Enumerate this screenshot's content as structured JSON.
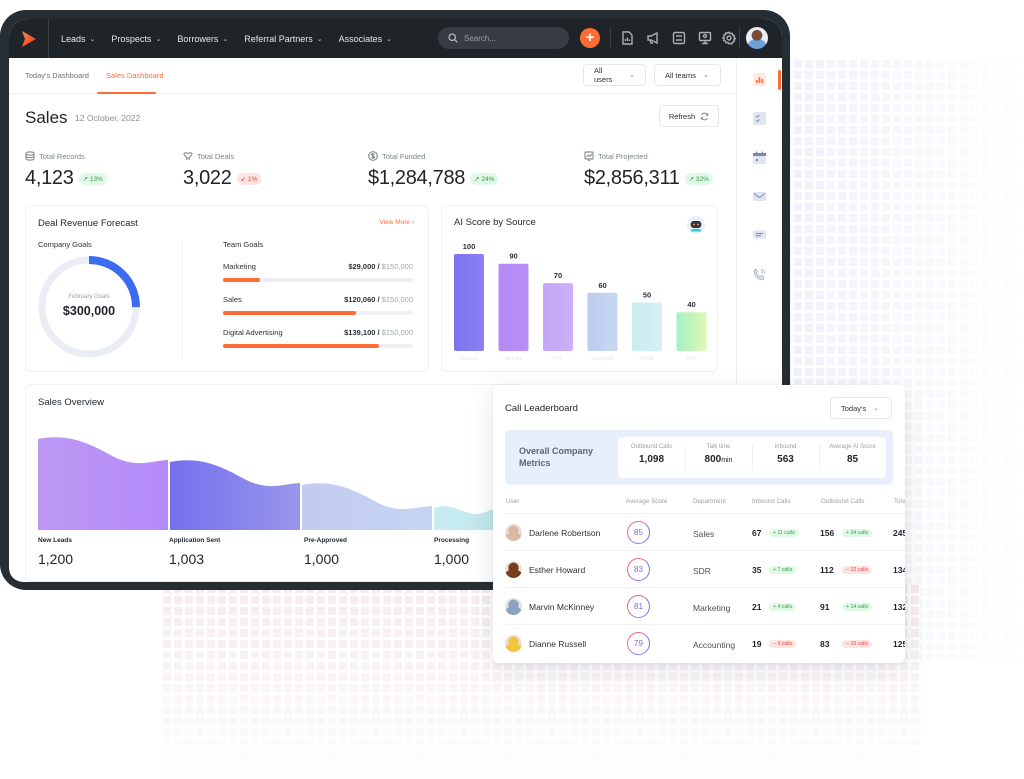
{
  "app": {
    "nav": [
      {
        "label": "Leads"
      },
      {
        "label": "Prospects"
      },
      {
        "label": "Borrowers"
      },
      {
        "label": "Referral Partners"
      },
      {
        "label": "Associates"
      }
    ],
    "search_placeholder": "Search...",
    "action_icons": [
      "report-icon",
      "megaphone-icon",
      "checklist-icon",
      "presentation-icon",
      "gear-icon"
    ],
    "accent": "#ff6b35"
  },
  "tabs": [
    {
      "label": "Today's Dashboard",
      "active": false
    },
    {
      "label": "Sales Dashboard",
      "active": true
    }
  ],
  "filters": {
    "users": "All users",
    "teams": "All teams"
  },
  "rail": [
    "bar-chart-icon",
    "checklist-icon",
    "calendar-icon",
    "mail-icon",
    "chat-icon",
    "phone-icon"
  ],
  "header": {
    "title": "Sales",
    "date": "12 October, 2022",
    "refresh_label": "Refresh"
  },
  "stats": [
    {
      "label": "Total Records",
      "value": "4,123",
      "change": "13%",
      "direction": "up"
    },
    {
      "label": "Total Deals",
      "value": "3,022",
      "change": "1%",
      "direction": "down"
    },
    {
      "label": "Total Funded",
      "value": "$1,284,788",
      "change": "24%",
      "direction": "up"
    },
    {
      "label": "Total Projected",
      "value": "$2,856,311",
      "change": "32%",
      "direction": "up"
    }
  ],
  "forecast": {
    "title": "Deal Revenue Forecast",
    "view_more": "View More",
    "company_goals_label": "Company Goals",
    "donut_label": "February Goals",
    "donut_value": "$300,000",
    "donut_progress": 0.25,
    "team_goals_label": "Team Goals",
    "goals": [
      {
        "name": "Marketing",
        "amount": "$29,000",
        "total": "$150,000",
        "progress": 0.193
      },
      {
        "name": "Sales",
        "amount": "$120,060",
        "total": "$150,000",
        "progress": 0.7
      },
      {
        "name": "Digital Advertising",
        "amount": "$139,100",
        "total": "$150,000",
        "progress": 0.82
      }
    ]
  },
  "chart_data": [
    {
      "type": "bar",
      "title": "AI Score by Source",
      "categories": [
        "Sourced",
        "Website",
        "PPC",
        "Leadpoint",
        "Portal",
        "FRU"
      ],
      "values": [
        100,
        90,
        70,
        60,
        50,
        40
      ],
      "colors": [
        [
          "#7b74ef",
          "#8b80f3"
        ],
        [
          "#b48af5",
          "#b98df6"
        ],
        [
          "#c3a6f7",
          "#cdb0f8"
        ],
        [
          "#bccbf0",
          "#c9d8f0"
        ],
        [
          "#c9ecf0",
          "#d6f1f2"
        ],
        [
          "#a6f0c4",
          "#e0f8b3"
        ]
      ],
      "xlabel": "",
      "ylabel": "",
      "ylim": [
        0,
        100
      ]
    },
    {
      "type": "area",
      "title": "Sales Overview",
      "categories": [
        "New Leads",
        "Application Sent",
        "Pre-Approved",
        "Processing"
      ],
      "values": [
        1200,
        1003,
        1000,
        1000
      ],
      "display_values": [
        "1,200",
        "1,003",
        "1,000",
        "1,000"
      ],
      "colors": [
        [
          "#bd98f3",
          "#b48af9"
        ],
        [
          "#7570ee",
          "#9896ec"
        ],
        [
          "#c3cbf0",
          "#c6d4f2"
        ],
        [
          "#c9ecf2",
          "#bfe6ea"
        ]
      ]
    }
  ],
  "leaderboard": {
    "title": "Call Leaderboard",
    "period": "Today's",
    "metrics_title": "Overall Company Metrics",
    "metrics": [
      {
        "label": "Outbound Calls",
        "value": "1,098",
        "unit": ""
      },
      {
        "label": "Talk time",
        "value": "800",
        "unit": "min"
      },
      {
        "label": "Inbound",
        "value": "563",
        "unit": ""
      },
      {
        "label": "Average AI Score",
        "value": "85",
        "unit": ""
      }
    ],
    "columns": [
      "User",
      "Average Score",
      "Department",
      "Inbound Calls",
      "Outbound Calls",
      "Total"
    ],
    "rows": [
      {
        "name": "Darlene Robertson",
        "score": "85",
        "department": "Sales",
        "inbound": "67",
        "inbound_delta": "+ 11 calls",
        "inbound_dir": "up",
        "outbound": "156",
        "outbound_delta": "+ 34 calls",
        "outbound_dir": "up",
        "total": "245",
        "avatar_color": "#d9b9a3"
      },
      {
        "name": "Esther Howard",
        "score": "83",
        "department": "SDR",
        "inbound": "35",
        "inbound_delta": "+ 7 calls",
        "inbound_dir": "up",
        "outbound": "112",
        "outbound_delta": "− 12 calls",
        "outbound_dir": "down",
        "total": "134",
        "avatar_color": "#7a3d1e"
      },
      {
        "name": "Marvin McKinney",
        "score": "81",
        "department": "Marketing",
        "inbound": "21",
        "inbound_delta": "+ 4 calls",
        "inbound_dir": "up",
        "outbound": "91",
        "outbound_delta": "+ 14 calls",
        "outbound_dir": "up",
        "total": "132",
        "avatar_color": "#8aa4c0"
      },
      {
        "name": "Dianne Russell",
        "score": "79",
        "department": "Accounting",
        "inbound": "19",
        "inbound_delta": "− 9 calls",
        "inbound_dir": "down",
        "outbound": "83",
        "outbound_delta": "− 10 calls",
        "outbound_dir": "down",
        "total": "125",
        "avatar_color": "#f3c53a"
      }
    ]
  }
}
